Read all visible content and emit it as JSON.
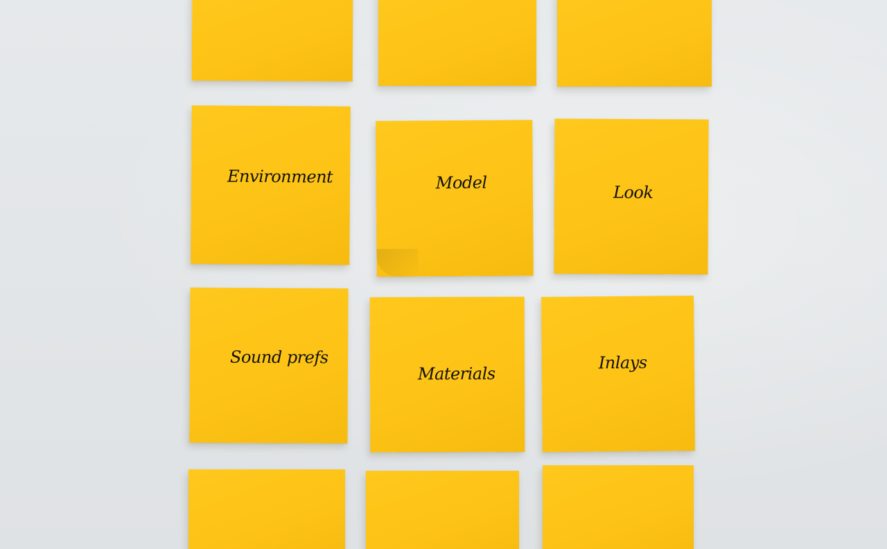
{
  "notes": [
    {
      "id": "top-left",
      "label": ""
    },
    {
      "id": "top-middle",
      "label": ""
    },
    {
      "id": "top-right",
      "label": ""
    },
    {
      "id": "environment",
      "label": "Environment"
    },
    {
      "id": "model",
      "label": "Model"
    },
    {
      "id": "look",
      "label": "Look"
    },
    {
      "id": "sound-prefs",
      "label": "Sound prefs"
    },
    {
      "id": "materials",
      "label": "Materials"
    },
    {
      "id": "inlays",
      "label": "Inlays"
    },
    {
      "id": "bottom-left",
      "label": ""
    },
    {
      "id": "bottom-middle",
      "label": ""
    },
    {
      "id": "bottom-right",
      "label": ""
    }
  ],
  "colors": {
    "note": "#fdc316",
    "wall": "#e3e6e8",
    "ink": "#111111"
  }
}
